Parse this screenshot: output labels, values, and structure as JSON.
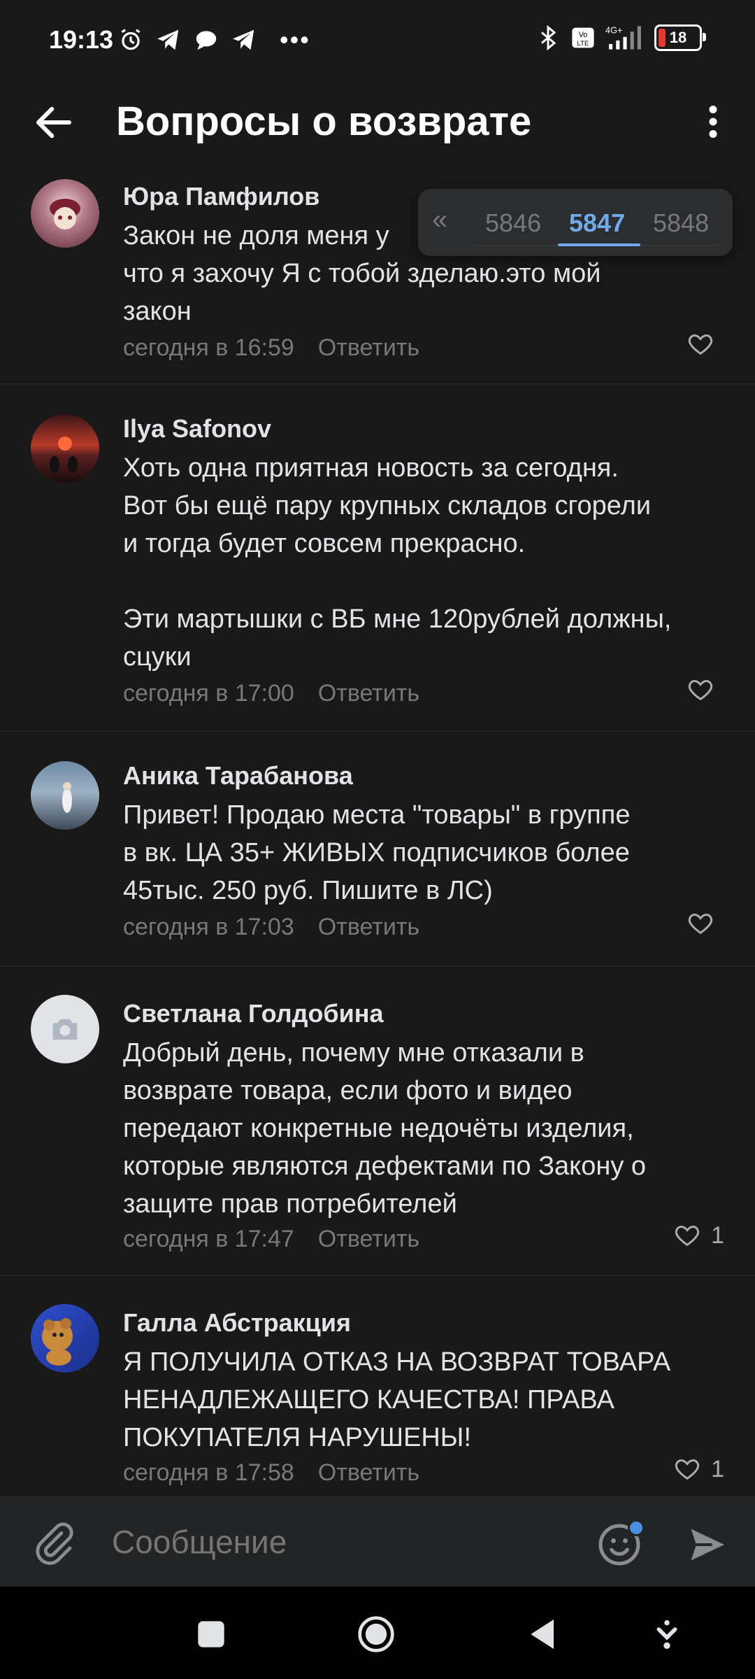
{
  "status_bar": {
    "time": "19:13",
    "battery": "18"
  },
  "header": {
    "title": "Вопросы о возврате"
  },
  "pager": {
    "prev": "«",
    "pages": [
      "5846",
      "5847",
      "5848"
    ],
    "current": "5847"
  },
  "comments": [
    {
      "author": "Юра Памфилов",
      "text": "Закон не доля меня у\nчто я захочу Я с тобой зделаю.это мой\nзакон",
      "time": "сегодня в 16:59",
      "reply": "Ответить",
      "likes": ""
    },
    {
      "author": "Ilya Safonov",
      "text": "Хоть одна приятная новость за сегодня.\nВот бы ещё пару крупных складов сгорели\nи тогда будет совсем прекрасно.\n\nЭти мартышки с ВБ мне 120рублей должны,\nсцуки",
      "time": "сегодня в 17:00",
      "reply": "Ответить",
      "likes": ""
    },
    {
      "author": "Аника Тарабанова",
      "text": "Привет! Продаю места \"товары\" в группе\nв вк. ЦА 35+ ЖИВЫХ подписчиков более\n45тыс. 250 руб. Пишите в ЛС)",
      "time": "сегодня в 17:03",
      "reply": "Ответить",
      "likes": ""
    },
    {
      "author": "Светлана Голдобина",
      "text": "Добрый день, почему мне отказали в\nвозврате товара, если фото и видео\nпередают конкретные недочёты изделия,\nкоторые являются дефектами по Закону о\nзащите прав потребителей",
      "time": "сегодня в 17:47",
      "reply": "Ответить",
      "likes": "1"
    },
    {
      "author": "Галла Абстракция",
      "text": "Я ПОЛУЧИЛА ОТКАЗ НА ВОЗВРАТ ТОВАРА\nНЕНАДЛЕЖАЩЕГО КАЧЕСТВА! ПРАВА\nПОКУПАТЕЛЯ НАРУШЕНЫ!",
      "time": "сегодня в 17:58",
      "reply": "Ответить",
      "likes": "1"
    }
  ],
  "composer": {
    "placeholder": "Сообщение"
  },
  "colors": {
    "background": "#19191a",
    "accent": "#71aaeb",
    "muted": "#76787a"
  }
}
